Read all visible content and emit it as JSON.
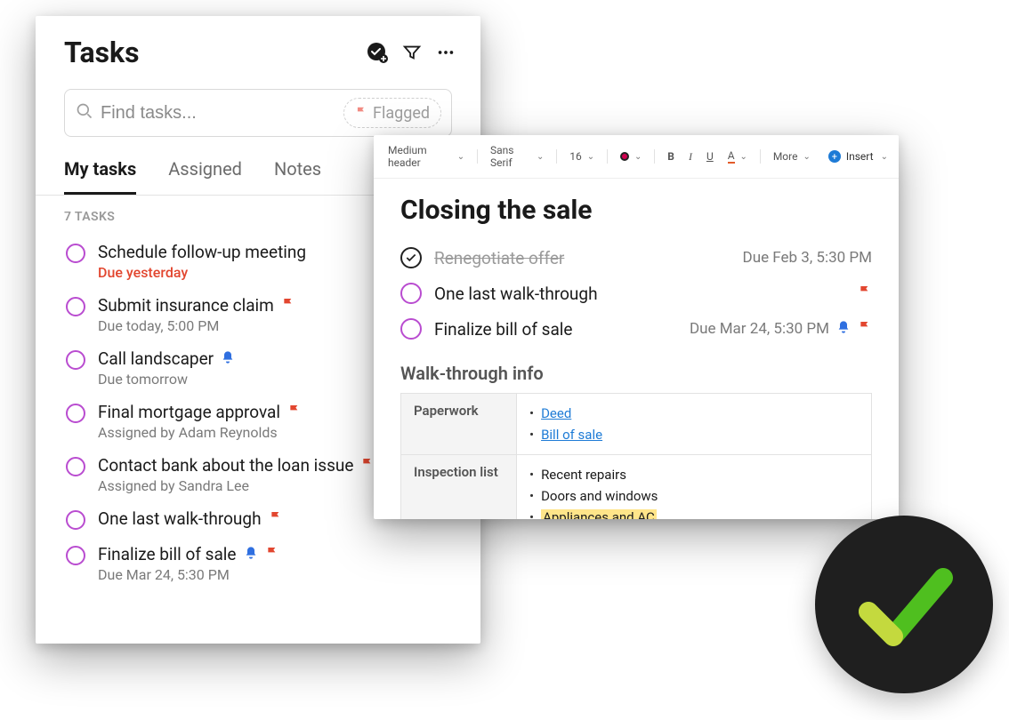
{
  "tasks_panel": {
    "title": "Tasks",
    "search_placeholder": "Find tasks...",
    "flagged_chip": "Flagged",
    "tabs": {
      "my_tasks": "My tasks",
      "assigned": "Assigned",
      "notes": "Notes"
    },
    "count_label": "7 TASKS",
    "items": [
      {
        "title": "Schedule follow-up meeting",
        "meta": "Due yesterday",
        "meta_red": true,
        "flag": false,
        "bell": false
      },
      {
        "title": "Submit insurance claim",
        "meta": "Due today, 5:00 PM",
        "meta_red": false,
        "flag": true,
        "bell": false
      },
      {
        "title": "Call landscaper",
        "meta": "Due tomorrow",
        "meta_red": false,
        "flag": false,
        "bell": true
      },
      {
        "title": "Final mortgage approval",
        "meta": "Assigned by Adam Reynolds",
        "meta_red": false,
        "flag": true,
        "bell": false
      },
      {
        "title": "Contact bank about the loan issue",
        "meta": "Assigned by Sandra Lee",
        "meta_red": false,
        "flag": true,
        "bell": false
      },
      {
        "title": "One last walk-through",
        "meta": "",
        "meta_red": false,
        "flag": true,
        "bell": false
      },
      {
        "title": "Finalize bill of sale",
        "meta": "Due Mar 24, 5:30 PM",
        "meta_red": false,
        "flag": true,
        "bell": true
      }
    ]
  },
  "note_panel": {
    "toolbar": {
      "style": "Medium header",
      "font": "Sans Serif",
      "size": "16",
      "more": "More",
      "insert": "Insert"
    },
    "title": "Closing the sale",
    "tasks": [
      {
        "title": "Renegotiate offer",
        "done": true,
        "due": "Due Feb 3, 5:30 PM",
        "flag": false,
        "bell": false
      },
      {
        "title": "One last walk-through",
        "done": false,
        "due": "",
        "flag": true,
        "bell": false
      },
      {
        "title": "Finalize bill of sale",
        "done": false,
        "due": "Due Mar 24, 5:30 PM",
        "flag": true,
        "bell": true
      }
    ],
    "section_heading": "Walk-through info",
    "table": {
      "paperwork_label": "Paperwork",
      "paperwork_items": {
        "deed": "Deed",
        "bill": "Bill of sale"
      },
      "inspection_label": "Inspection list",
      "inspection_items": {
        "repairs": "Recent repairs",
        "doors": "Doors and windows",
        "appliances": "Appliances and AC"
      }
    }
  }
}
